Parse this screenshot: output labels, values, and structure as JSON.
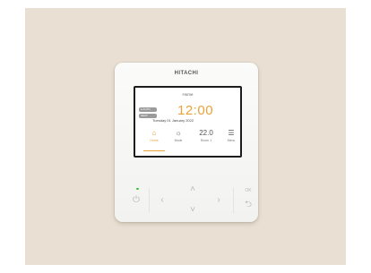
{
  "brand": "HITACHI",
  "screen": {
    "title": "Home",
    "status_pills": [
      "● AUTO",
      "HEAT"
    ],
    "time": "12:00",
    "date": "Tuesday 01 January 2022",
    "tabs": [
      {
        "label": "Home",
        "icon": "house-icon",
        "active": true
      },
      {
        "label": "Mode",
        "icon": "sun-icon",
        "active": false
      },
      {
        "label": "Room 1",
        "value": "22.0",
        "icon": "temperature-icon",
        "active": false
      },
      {
        "label": "Menu",
        "icon": "menu-icon",
        "active": false
      }
    ]
  },
  "buttons": {
    "power": "power-icon",
    "left": "chevron-left-icon",
    "up": "chevron-up-icon",
    "down": "chevron-down-icon",
    "right": "chevron-right-icon",
    "ok_label": "OK",
    "back": "return-icon"
  },
  "colors": {
    "accent": "#e8a33a",
    "wall": "#e9e0d3",
    "led": "#38c23b"
  }
}
